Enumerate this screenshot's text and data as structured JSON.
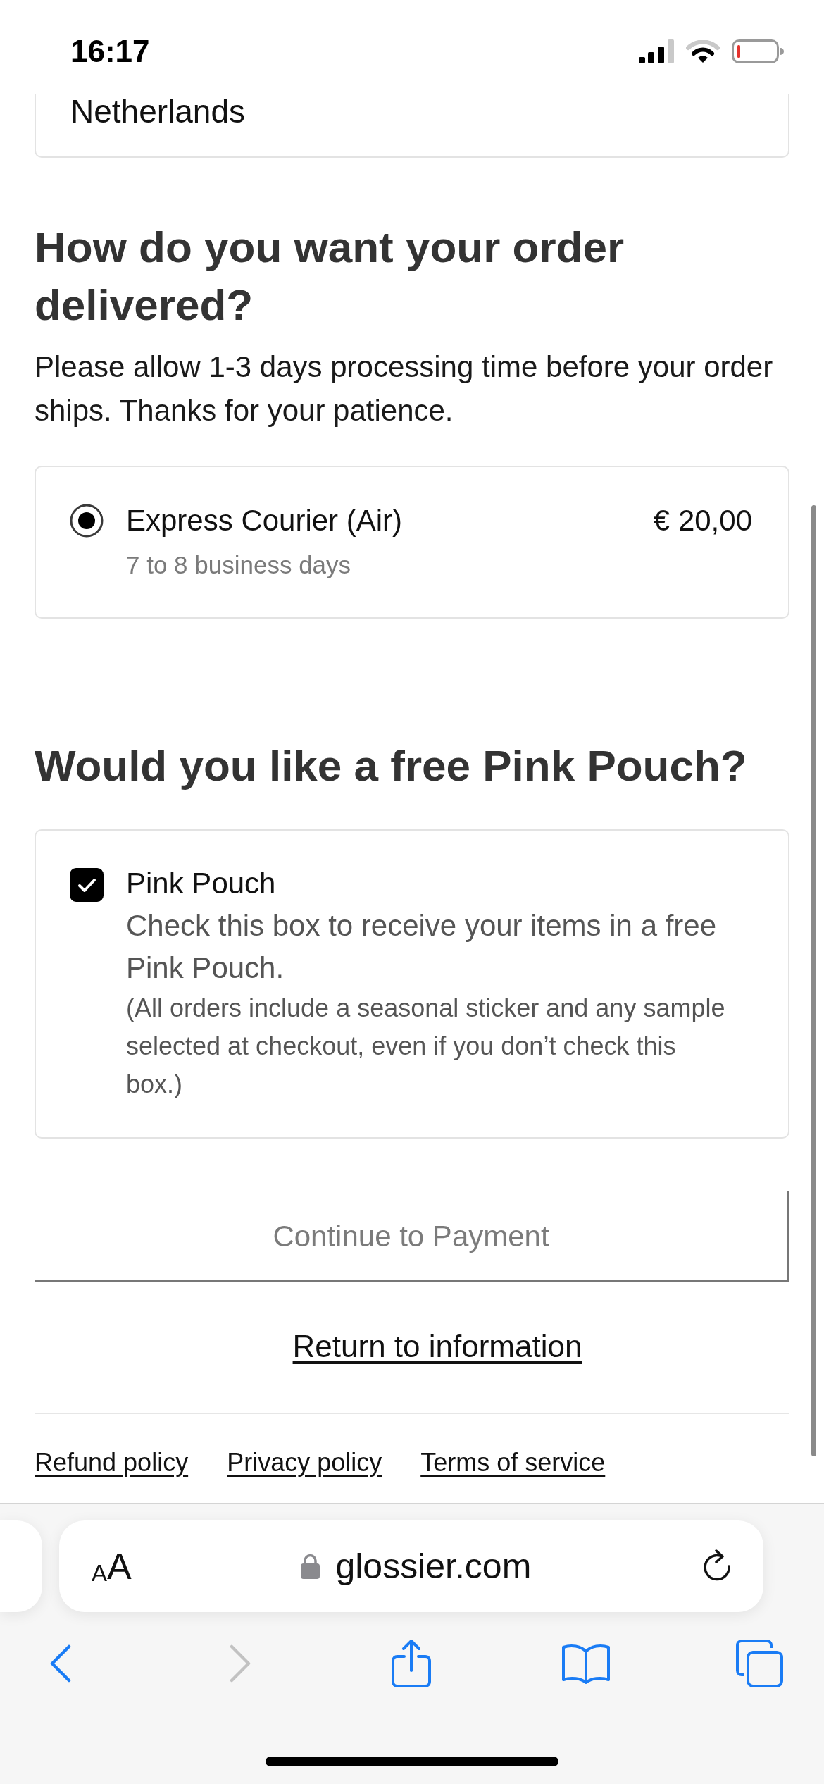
{
  "status_bar": {
    "time": "16:17"
  },
  "address_card": {
    "country": "Netherlands"
  },
  "delivery": {
    "heading": "How do you want your order delivered?",
    "note": "Please allow 1-3 days processing time before your order ships. Thanks for your patience.",
    "options": [
      {
        "name": "Express Courier (Air)",
        "time": "7 to 8 business days",
        "price": "€ 20,00",
        "selected": true
      }
    ]
  },
  "pink_pouch": {
    "heading": "Would you like a free Pink Pouch?",
    "option": {
      "label": "Pink Pouch",
      "description": "Check this box to receive your items in a free Pink Pouch.",
      "note": "(All orders include a seasonal sticker and any sample selected at checkout, even if you don’t check this box.)",
      "checked": true
    }
  },
  "continue_button": {
    "label": "Continue to Payment",
    "disabled": true
  },
  "return_link": {
    "label": "Return to information"
  },
  "footer_links": [
    "Refund policy",
    "Privacy policy",
    "Terms of service"
  ],
  "browser": {
    "text_size_button": "AA",
    "url": "glossier.com",
    "back": {
      "disabled": false
    },
    "forward": {
      "disabled": true
    }
  }
}
